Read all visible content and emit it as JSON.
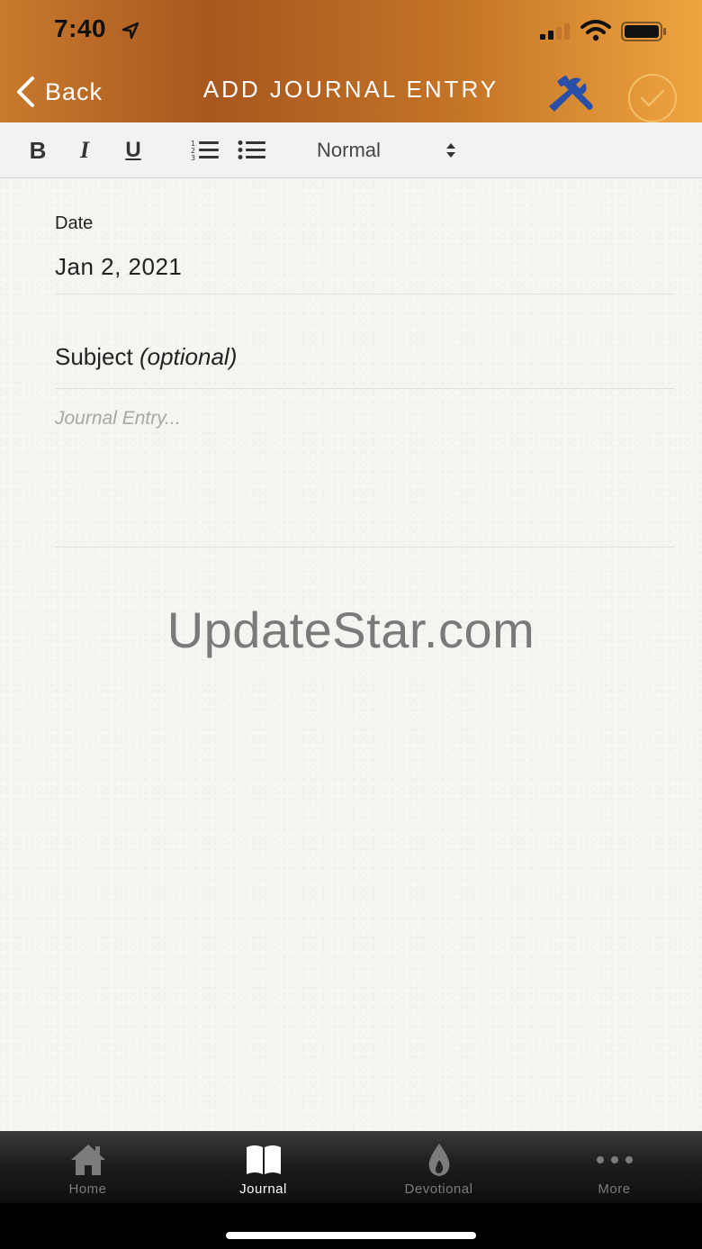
{
  "status_bar": {
    "time": "7:40"
  },
  "nav": {
    "back_label": "Back",
    "title": "ADD JOURNAL ENTRY"
  },
  "toolbar": {
    "bold": "B",
    "italic": "I",
    "underline": "U",
    "format_value": "Normal"
  },
  "form": {
    "date_label": "Date",
    "date_value": "Jan 2, 2021",
    "subject_label": "Subject",
    "subject_hint": "(optional)",
    "entry_placeholder": "Journal Entry..."
  },
  "watermark": "UpdateStar.com",
  "tabs": [
    {
      "label": "Home",
      "icon": "home-icon",
      "active": false
    },
    {
      "label": "Journal",
      "icon": "book-icon",
      "active": true
    },
    {
      "label": "Devotional",
      "icon": "flame-icon",
      "active": false
    },
    {
      "label": "More",
      "icon": "more-icon",
      "active": false
    }
  ],
  "colors": {
    "header_start": "#c97a2c",
    "header_end": "#efa440",
    "tools_icon": "#2a4fa8",
    "confirm_ring": "#f3c06a"
  }
}
